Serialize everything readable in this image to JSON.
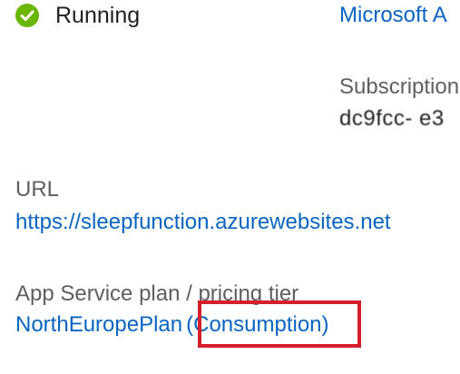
{
  "status": {
    "text": "Running",
    "icon": "check-circle-icon",
    "icon_color": "#6bb700"
  },
  "right_column": {
    "resource_group_link": "Microsoft A",
    "subscription_label": "Subscription",
    "subscription_value": "dc9fcc- e3"
  },
  "url": {
    "label": "URL",
    "value": "https://sleepfunction.azurewebsites.net"
  },
  "plan": {
    "label": "App Service plan / pricing tier",
    "name": "NorthEuropePlan",
    "tier": "(Consumption)"
  },
  "colors": {
    "link": "#0a65c1",
    "label": "#5f5f5f",
    "highlight": "#d51f2a"
  }
}
